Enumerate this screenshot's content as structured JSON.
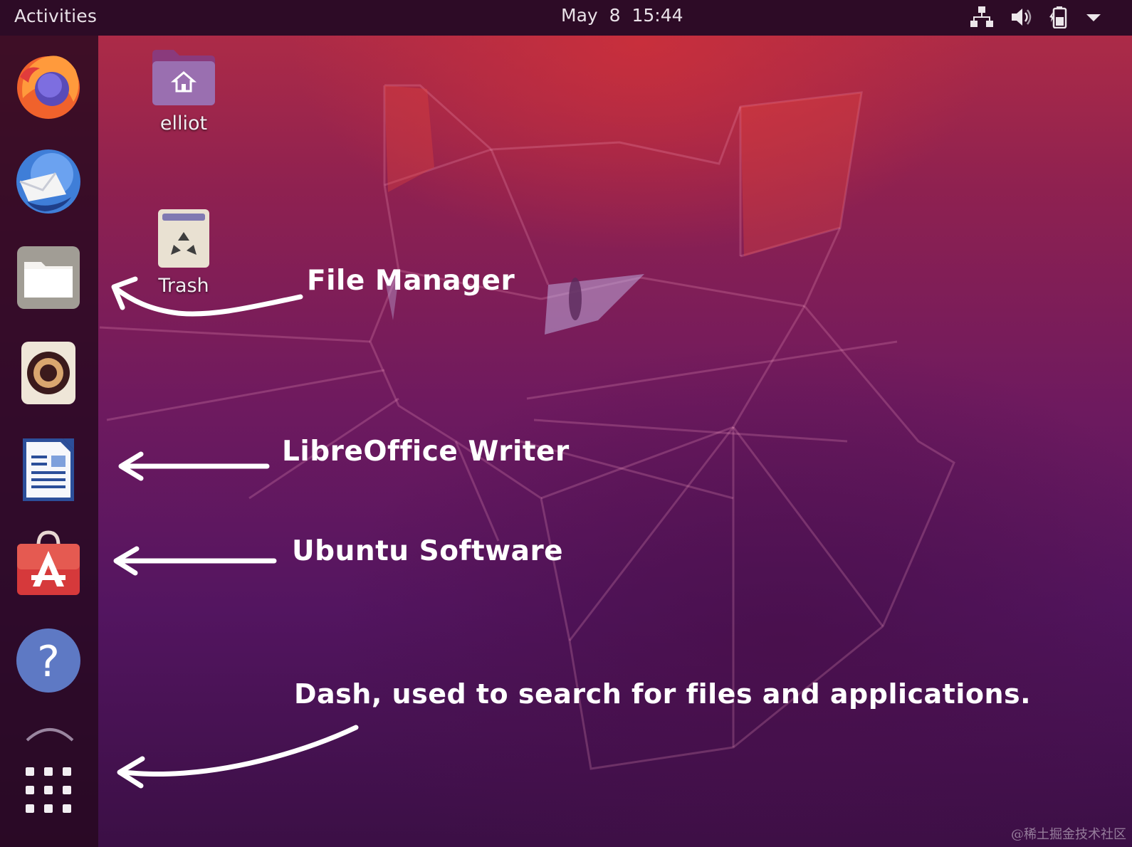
{
  "topbar": {
    "activities_label": "Activities",
    "clock": "May 8  15:44",
    "tray_icons": [
      "network-icon",
      "volume-icon",
      "battery-icon",
      "system-menu-icon"
    ]
  },
  "dock": {
    "items": [
      {
        "name": "Firefox",
        "icon": "firefox-icon"
      },
      {
        "name": "Thunderbird",
        "icon": "thunderbird-icon"
      },
      {
        "name": "Files",
        "icon": "files-icon"
      },
      {
        "name": "Rhythmbox",
        "icon": "rhythmbox-icon"
      },
      {
        "name": "LibreOffice Writer",
        "icon": "writer-icon"
      },
      {
        "name": "Ubuntu Software",
        "icon": "software-icon"
      },
      {
        "name": "Help",
        "icon": "help-icon"
      },
      {
        "name": "Show Applications",
        "icon": "grid-icon"
      }
    ]
  },
  "desktop": {
    "icons": [
      {
        "label": "elliot",
        "icon": "home-folder-icon"
      },
      {
        "label": "Trash",
        "icon": "trash-icon"
      }
    ]
  },
  "annotations": {
    "file_manager": "File Manager",
    "writer": "LibreOffice Writer",
    "software": "Ubuntu Software",
    "dash": "Dash, used to search for files and applications."
  },
  "watermark": "@稀土掘金技术社区",
  "colors": {
    "topbar": "#2d0b26",
    "dock": "#26081e",
    "wallpaper_top": "#b32d45",
    "wallpaper_bottom": "#3b0f45",
    "annotation_text": "#ffffff"
  }
}
